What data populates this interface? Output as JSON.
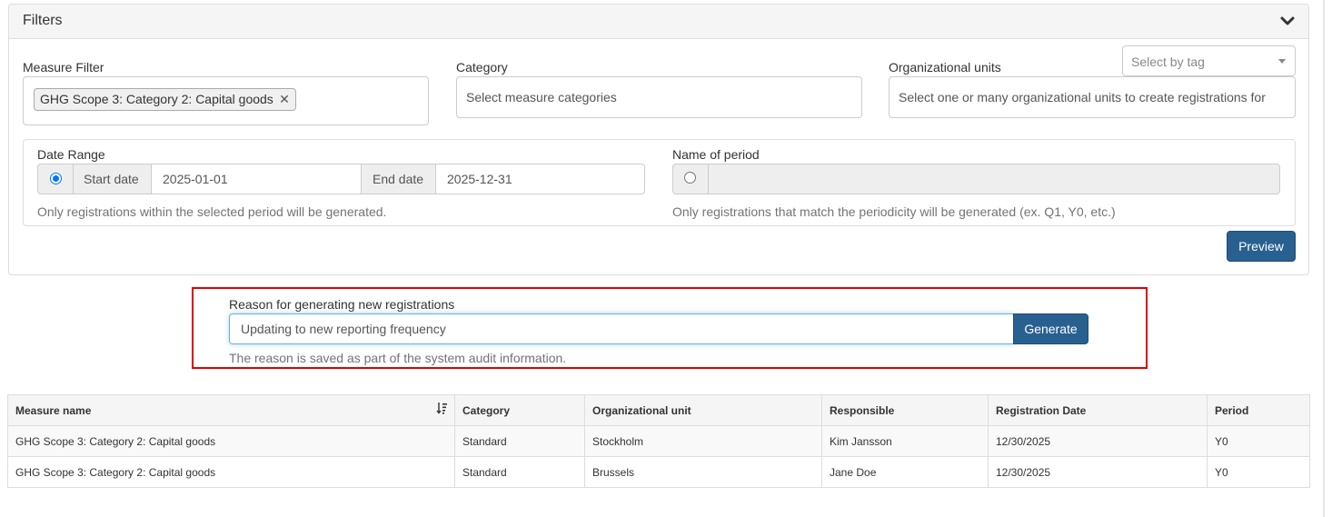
{
  "filters": {
    "title": "Filters",
    "collapse_icon": "chevron-down-icon",
    "measure_filter": {
      "label": "Measure Filter",
      "selected_chip": "GHG Scope 3: Category 2: Capital goods",
      "remove_icon": "close-icon"
    },
    "category": {
      "label": "Category",
      "placeholder": "Select measure categories"
    },
    "org_units": {
      "label": "Organizational units",
      "placeholder": "Select one or many organizational units to create registrations for"
    },
    "tag_select": {
      "placeholder": "Select by tag"
    },
    "date_range": {
      "label": "Date Range",
      "selected": true,
      "start_label": "Start date",
      "start_value": "2025-01-01",
      "end_label": "End date",
      "end_value": "2025-12-31",
      "help": "Only registrations within the selected period will be generated."
    },
    "period_name": {
      "label": "Name of period",
      "selected": false,
      "value": "",
      "help": "Only registrations that match the periodicity will be generated (ex. Q1, Y0, etc.)"
    },
    "preview_label": "Preview"
  },
  "reason": {
    "label": "Reason for generating new registrations",
    "value": "Updating to new reporting frequency",
    "generate_label": "Generate",
    "help": "The reason is saved as part of the system audit information."
  },
  "table": {
    "columns": [
      "Measure name",
      "Category",
      "Organizational unit",
      "Responsible",
      "Registration Date",
      "Period"
    ],
    "sort_icon": "sort-amount-down-icon",
    "rows": [
      [
        "GHG Scope 3: Category 2: Capital goods",
        "Standard",
        "Stockholm",
        "Kim Jansson",
        "12/30/2025",
        "Y0"
      ],
      [
        "GHG Scope 3: Category 2: Capital goods",
        "Standard",
        "Brussels",
        "Jane Doe",
        "12/30/2025",
        "Y0"
      ]
    ]
  },
  "colors": {
    "primary_button": "#286090",
    "highlight_border": "#e00000",
    "radio_selected": "#0075ff"
  }
}
